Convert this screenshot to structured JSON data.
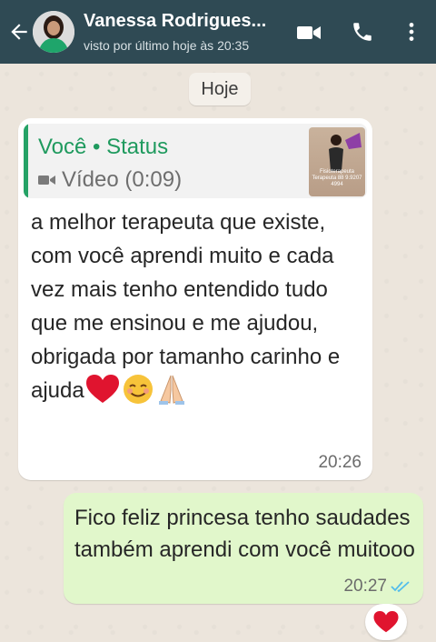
{
  "header": {
    "contact_name": "Vanessa Rodrigues...",
    "last_seen": "visto por último hoje às 20:35",
    "icons": [
      "back-arrow-icon",
      "avatar",
      "video-call-icon",
      "phone-call-icon",
      "more-options-icon"
    ]
  },
  "chat": {
    "date_chip": "Hoje",
    "incoming": {
      "quote_author": "Você • Status",
      "quote_media": "Vídeo (0:09)",
      "thumb_caption": "Fisioterapeuta Terapeuta 88 9.9207 4994",
      "text": "a melhor terapeuta que existe, com você aprendi muito e cada vez mais tenho entendido tudo que me ensinou e me ajudou, obrigada por tamanho carinho e ajuda",
      "emojis": [
        "heart",
        "smiling-face",
        "folded-hands"
      ],
      "time": "20:26"
    },
    "outgoing": {
      "text": "Fico feliz princesa tenho saudades também aprendi com você muitooo",
      "time": "20:27",
      "status": "read",
      "reaction": "heart"
    }
  },
  "colors": {
    "header_bg": "#2f4a54",
    "outgoing_bubble": "#e1f7cb",
    "quote_accent": "#25a266",
    "read_ticks": "#53bdeb",
    "heart": "#e0142f"
  }
}
